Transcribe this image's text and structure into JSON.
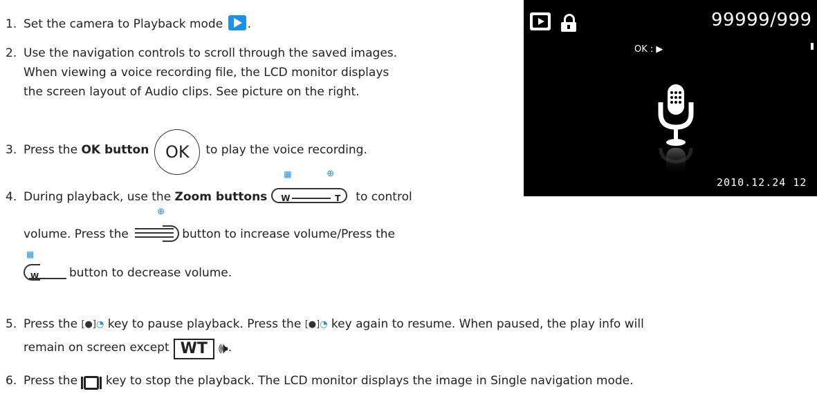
{
  "steps": [
    {
      "num": "1.",
      "text_before": "Set the camera to Playback mode ",
      "text_after": "."
    },
    {
      "num": "2.",
      "line1": "Use the navigation controls to scroll through the saved images.",
      "line2": "When viewing a voice recording file, the LCD monitor displays",
      "line3": "the screen layout of Audio clips. See picture on the right."
    },
    {
      "num": "3.",
      "text_before": "Press the ",
      "bold": "OK button",
      "ok_glyph": "OK",
      "text_after": "to play the voice recording."
    },
    {
      "num": "4.",
      "text_before": "During playback, use the ",
      "bold": "Zoom buttons",
      "zoom_w": "W",
      "zoom_t": "T",
      "text_after": "to control",
      "line2_before": "volume. Press the ",
      "line2_after": "button to increase volume/Press the",
      "line3_after": "button to decrease volume."
    },
    {
      "num": "5.",
      "text_a": "Press the ",
      "text_b": " key to pause playback. Press the ",
      "text_c": " key again to resume. When paused, the play info will",
      "line2": "remain on screen except",
      "wt": "WT",
      "end": "."
    },
    {
      "num": "6.",
      "text_before": "Press the ",
      "text_after": " key to stop the playback. The LCD monitor displays the image in Single navigation mode."
    }
  ],
  "lcd": {
    "counter": "99999/999",
    "ok_play": "OK : ▶",
    "date": "2010.12.24  12"
  },
  "icons": {
    "playback": "playback-mode-icon",
    "ok": "ok-button-icon",
    "zoom": "zoom-buttons-icon",
    "voice": "voice-key-icon",
    "stop": "stop-key-icon",
    "speaker": "speaker-icon",
    "mic": "microphone-icon",
    "lock": "lock-icon"
  },
  "colors": {
    "accent": "#1e90e8",
    "lcd_bg": "#000000"
  }
}
